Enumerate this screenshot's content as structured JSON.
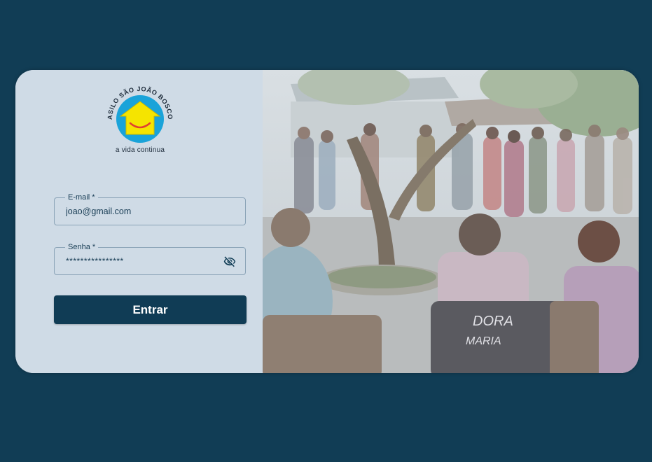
{
  "logo": {
    "arc_text": "ASILO SÃO JOÃO BOSCO",
    "caption": "a vida continua",
    "icon": "house-smile-logo",
    "colors": {
      "circle": "#1aa3d9",
      "house": "#f5e400",
      "smile": "#e04030"
    }
  },
  "form": {
    "email": {
      "label": "E-mail *",
      "value": "joao@gmail.com"
    },
    "password": {
      "label": "Senha *",
      "value": "****************",
      "toggle_icon": "eye-off-icon"
    },
    "submit_label": "Entrar"
  },
  "photo": {
    "description_icon": "community-gathering-photo",
    "texts": [
      "DORA",
      "MARIA"
    ]
  },
  "colors": {
    "background": "#113d55",
    "panel": "#cfdbe6",
    "button": "#103c55"
  }
}
